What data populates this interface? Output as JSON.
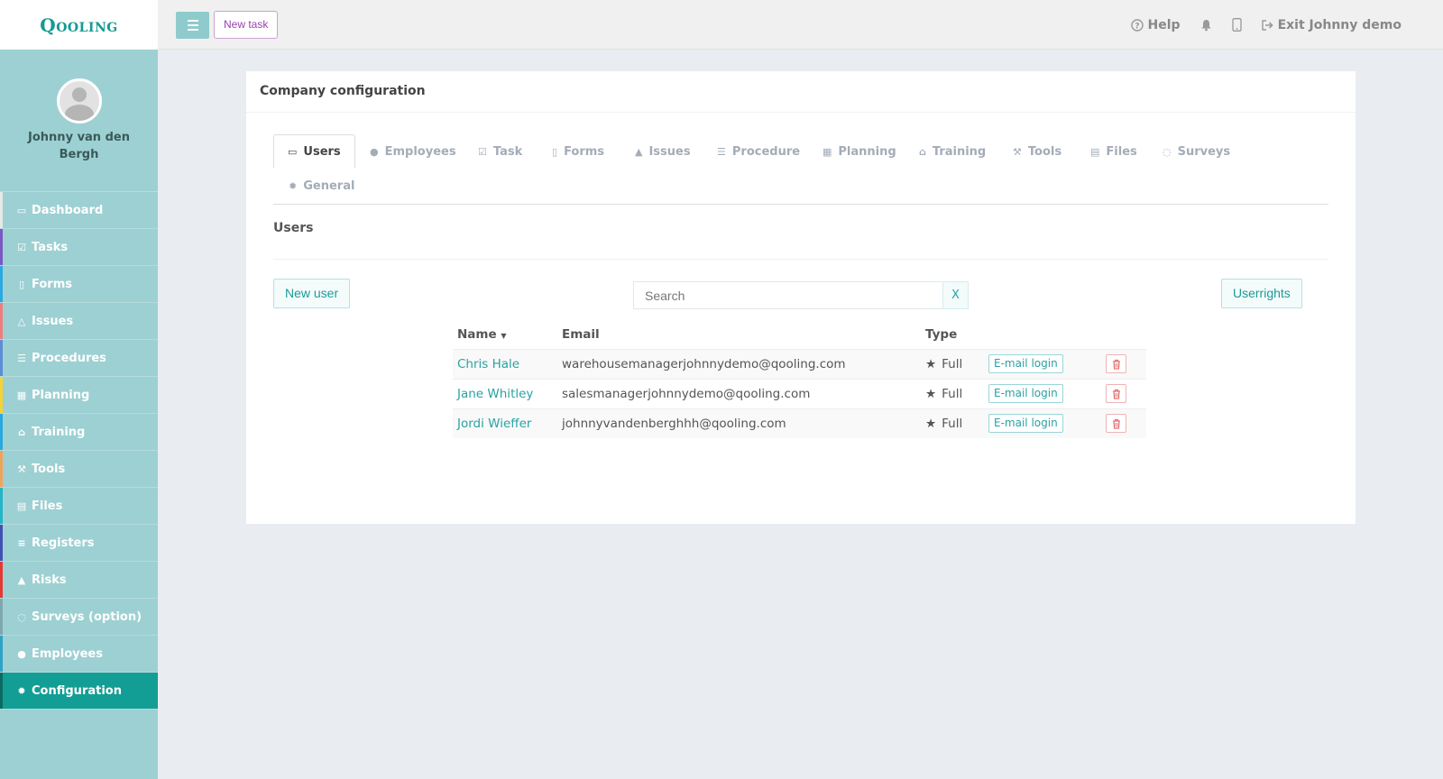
{
  "app": {
    "logo": "Qooling"
  },
  "topbar": {
    "new_task_label": "New task",
    "help_label": "Help",
    "exit_label": "Exit Johnny demo"
  },
  "user": {
    "name": "Johnny van den Bergh"
  },
  "sidebar": {
    "items": [
      {
        "label": "Dashboard",
        "icon": "monitor-icon",
        "color": "#e8e8e8"
      },
      {
        "label": "Tasks",
        "icon": "check-square-icon",
        "color": "#7e57c2"
      },
      {
        "label": "Forms",
        "icon": "document-icon",
        "color": "#29a9e1"
      },
      {
        "label": "Issues",
        "icon": "bell-icon",
        "color": "#ef7d7d"
      },
      {
        "label": "Procedures",
        "icon": "list-icon",
        "color": "#5c8ed6"
      },
      {
        "label": "Planning",
        "icon": "calendar-icon",
        "color": "#f3d23a"
      },
      {
        "label": "Training",
        "icon": "graduation-cap-icon",
        "color": "#26a9e0"
      },
      {
        "label": "Tools",
        "icon": "wrench-icon",
        "color": "#f0a35a"
      },
      {
        "label": "Files",
        "icon": "file-icon",
        "color": "#22b5c9"
      },
      {
        "label": "Registers",
        "icon": "register-icon",
        "color": "#3f51b5"
      },
      {
        "label": "Risks",
        "icon": "warning-icon",
        "color": "#e53935"
      },
      {
        "label": "Surveys (option)",
        "icon": "comment-icon",
        "color": "#7fa8ad"
      },
      {
        "label": "Employees",
        "icon": "users-icon",
        "color": "#2ea3c7"
      },
      {
        "label": "Configuration",
        "icon": "gear-icon",
        "color": "#0b6b63"
      }
    ]
  },
  "card": {
    "title": "Company configuration"
  },
  "tabs": [
    {
      "label": "Users",
      "icon": "id-card-icon"
    },
    {
      "label": "Employees",
      "icon": "users-icon"
    },
    {
      "label": "Task",
      "icon": "check-square-icon"
    },
    {
      "label": "Forms",
      "icon": "document-icon"
    },
    {
      "label": "Issues",
      "icon": "bell-icon"
    },
    {
      "label": "Procedure",
      "icon": "list-icon"
    },
    {
      "label": "Planning",
      "icon": "calendar-icon"
    },
    {
      "label": "Training",
      "icon": "graduation-cap-icon"
    },
    {
      "label": "Tools",
      "icon": "wrench-icon"
    },
    {
      "label": "Files",
      "icon": "file-icon"
    },
    {
      "label": "Surveys",
      "icon": "comment-icon"
    },
    {
      "label": "General",
      "icon": "gear-icon"
    }
  ],
  "users_section": {
    "title": "Users",
    "new_user_label": "New user",
    "search_placeholder": "Search",
    "clear_label": "X",
    "userrights_label": "Userrights",
    "columns": {
      "name": "Name",
      "email": "Email",
      "type": "Type"
    },
    "rows": [
      {
        "name": "Chris Hale",
        "email": "warehousemanagerjohnnydemo@qooling.com",
        "type": "Full",
        "login": "E-mail login"
      },
      {
        "name": "Jane Whitley",
        "email": "salesmanagerjohnnydemo@qooling.com",
        "type": "Full",
        "login": "E-mail login"
      },
      {
        "name": "Jordi Wieffer",
        "email": "johnnyvandenberghhh@qooling.com",
        "type": "Full",
        "login": "E-mail login"
      }
    ]
  },
  "colors": {
    "accent": "#2aa1a3",
    "sidebar_bg": "#9dd0d2",
    "active_nav": "#129e94",
    "danger": "#e57373"
  }
}
